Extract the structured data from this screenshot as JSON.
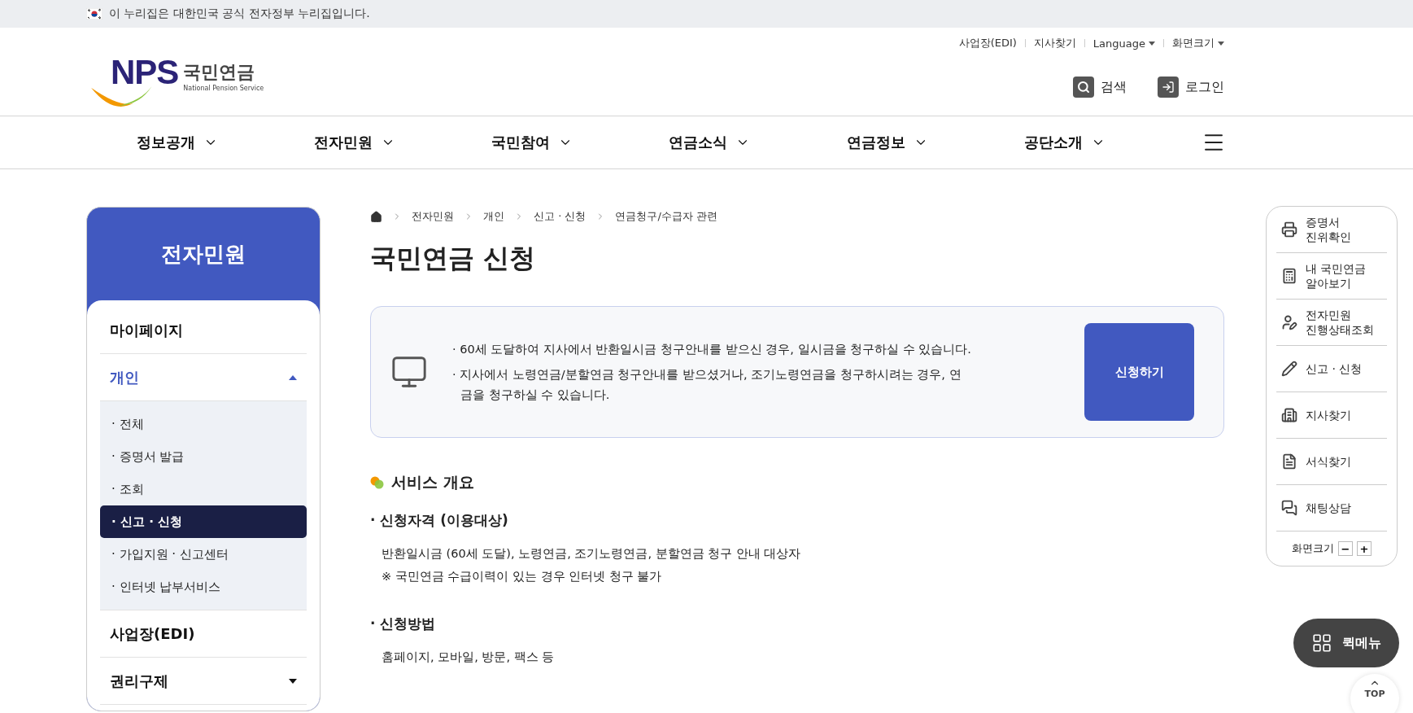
{
  "gov_banner": {
    "text": "이 누리집은 대한민국 공식 전자정부 누리집입니다."
  },
  "logo": {
    "mark": "NPS",
    "name": "국민연금",
    "subtitle": "National Pension Service"
  },
  "utility_links": [
    {
      "label": "사업장(EDI)",
      "has_menu": false
    },
    {
      "label": "지사찾기",
      "has_menu": false
    },
    {
      "label": "Language",
      "has_menu": true
    },
    {
      "label": "화면크기",
      "has_menu": true
    }
  ],
  "header_actions": [
    {
      "label": "검색",
      "kind": "search"
    },
    {
      "label": "로그인",
      "kind": "login"
    }
  ],
  "nav": [
    "정보공개",
    "전자민원",
    "국민참여",
    "연금소식",
    "연금정보",
    "공단소개"
  ],
  "sidebar": {
    "title": "전자민원",
    "items": [
      {
        "label": "마이페이지",
        "kind": "link"
      },
      {
        "label": "개인",
        "kind": "group",
        "expanded": true,
        "children": [
          {
            "label": "· 전체",
            "selected": false
          },
          {
            "label": "· 증명서 발급",
            "selected": false
          },
          {
            "label": "· 조회",
            "selected": false
          },
          {
            "label": "· 신고 · 신청",
            "selected": true
          },
          {
            "label": "· 가입지원 · 신고센터",
            "selected": false
          },
          {
            "label": "· 인터넷 납부서비스",
            "selected": false
          }
        ]
      },
      {
        "label": "사업장(EDI)",
        "kind": "link"
      },
      {
        "label": "권리구제",
        "kind": "group",
        "expanded": false
      }
    ]
  },
  "breadcrumb": [
    "전자민원",
    "개인",
    "신고 · 신청",
    "연금청구/수급자 관련"
  ],
  "title": "국민연금 신청",
  "notice": {
    "items": [
      "· 60세 도달하여 지사에서 반환일시금 청구안내를 받으신 경우, 일시금을 청구하실 수 있습니다.",
      "· 지사에서 노령연금/분할연금 청구안내를 받으셨거나, 조기노령연금을 청구하시려는 경우, 연금을 청구하실 수 있습니다."
    ],
    "button": "신청하기"
  },
  "overview": {
    "heading": "서비스 개요",
    "sections": [
      {
        "heading": "· 신청자격 (이용대상)",
        "lines": [
          "반환일시금 (60세 도달), 노령연금, 조기노령연금, 분할연금 청구 안내 대상자",
          "※ 국민연금 수급이력이 있는 경우 인터넷 청구 불가"
        ]
      },
      {
        "heading": "· 신청방법",
        "lines": [
          "홈페이지, 모바일, 방문, 팩스 등"
        ]
      }
    ]
  },
  "quick_panel": {
    "items": [
      {
        "lines": [
          "증명서",
          "진위확인"
        ],
        "kind": "printer"
      },
      {
        "lines": [
          "내 국민연금",
          "알아보기"
        ],
        "kind": "calculator"
      },
      {
        "lines": [
          "전자민원",
          "진행상태조회"
        ],
        "kind": "user"
      },
      {
        "lines": [
          "신고 · 신청"
        ],
        "kind": "pen"
      },
      {
        "lines": [
          "지사찾기"
        ],
        "kind": "building"
      },
      {
        "lines": [
          "서식찾기"
        ],
        "kind": "document"
      },
      {
        "lines": [
          "채팅상담"
        ],
        "kind": "chat"
      }
    ],
    "zoom": {
      "label": "화면크기",
      "minus": "−",
      "plus": "+"
    }
  },
  "quick_menu_button": "퀵메뉴",
  "top_button": "TOP"
}
